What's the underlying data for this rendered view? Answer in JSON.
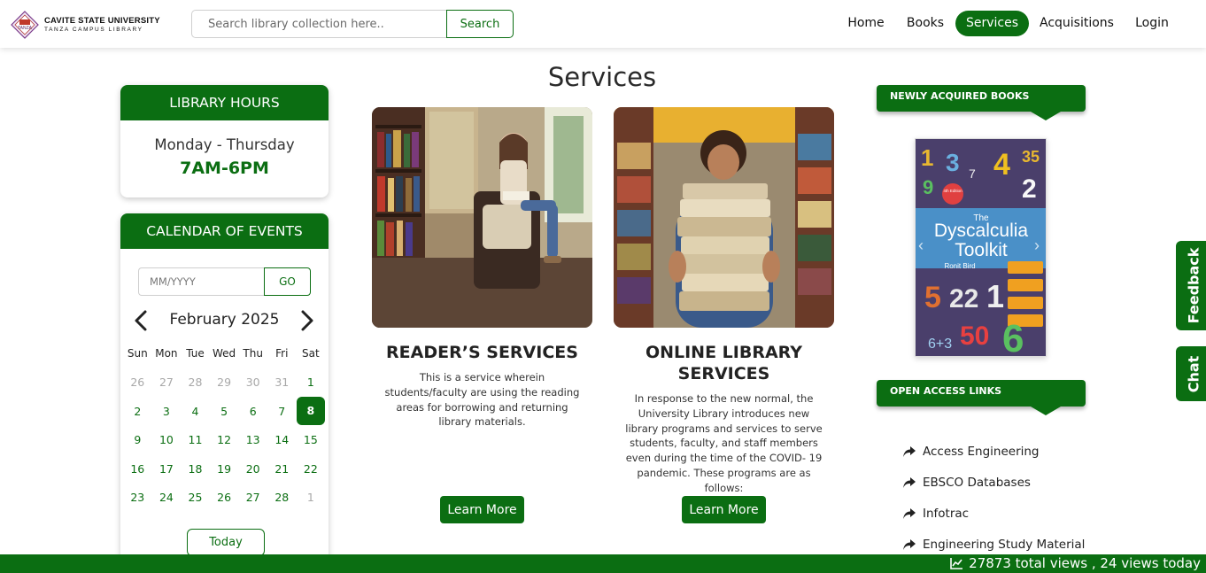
{
  "header": {
    "brand_title": "CAVITE STATE UNIVERSITY",
    "brand_subtitle": "TANZA CAMPUS LIBRARY",
    "logo_text": "TANZA",
    "search_placeholder": "Search library collection here..",
    "search_button": "Search",
    "nav": [
      {
        "label": "Home",
        "active": false
      },
      {
        "label": "Books",
        "active": false
      },
      {
        "label": "Services",
        "active": true
      },
      {
        "label": "Acquisitions",
        "active": false
      },
      {
        "label": "Login",
        "active": false
      }
    ]
  },
  "library_hours": {
    "title": "LIBRARY HOURS",
    "days": "Monday - Thursday",
    "time": "7AM-6PM"
  },
  "calendar": {
    "title": "CALENDAR OF EVENTS",
    "input_placeholder": "MM/YYYY",
    "go_button": "GO",
    "month_label": "February 2025",
    "weekdays": [
      "Sun",
      "Mon",
      "Tue",
      "Wed",
      "Thu",
      "Fri",
      "Sat"
    ],
    "weeks": [
      [
        {
          "d": "26",
          "m": true
        },
        {
          "d": "27",
          "m": true
        },
        {
          "d": "28",
          "m": true
        },
        {
          "d": "29",
          "m": true
        },
        {
          "d": "30",
          "m": true
        },
        {
          "d": "31",
          "m": true
        },
        {
          "d": "1"
        }
      ],
      [
        {
          "d": "2"
        },
        {
          "d": "3"
        },
        {
          "d": "4"
        },
        {
          "d": "5"
        },
        {
          "d": "6"
        },
        {
          "d": "7"
        },
        {
          "d": "8",
          "today": true
        }
      ],
      [
        {
          "d": "9"
        },
        {
          "d": "10"
        },
        {
          "d": "11"
        },
        {
          "d": "12"
        },
        {
          "d": "13"
        },
        {
          "d": "14"
        },
        {
          "d": "15"
        }
      ],
      [
        {
          "d": "16"
        },
        {
          "d": "17"
        },
        {
          "d": "18"
        },
        {
          "d": "19"
        },
        {
          "d": "20"
        },
        {
          "d": "21"
        },
        {
          "d": "22"
        }
      ],
      [
        {
          "d": "23"
        },
        {
          "d": "24"
        },
        {
          "d": "25"
        },
        {
          "d": "26"
        },
        {
          "d": "27"
        },
        {
          "d": "28"
        },
        {
          "d": "1",
          "m": true
        }
      ]
    ],
    "today_button": "Today"
  },
  "main": {
    "title": "Services",
    "services": [
      {
        "title": "READER’S SERVICES",
        "description": "This is a service wherein students/faculty are using the reading areas for borrowing and returning library materials.",
        "button": "Learn More"
      },
      {
        "title": "ONLINE LIBRARY SERVICES",
        "description": "In response to the new normal, the University Library introduces new library programs and services to serve students, faculty, and staff members even during the time of the COVID- 19 pandemic. These programs are as follows:",
        "button": "Learn More"
      }
    ]
  },
  "right": {
    "new_books_title": "NEWLY ACQUIRED BOOKS",
    "book": {
      "title_line1": "The",
      "title_line2": "Dyscalculia",
      "title_line3": "Toolkit",
      "author": "Ronit Bird",
      "edition": "4th Edition"
    },
    "open_access_title": "OPEN ACCESS LINKS",
    "links": [
      "Access Engineering",
      "EBSCO Databases",
      "Infotrac",
      "Engineering Study Material"
    ]
  },
  "side_tabs": {
    "feedback": "Feedback",
    "chat": "Chat"
  },
  "footer": {
    "stats": "27873 total views , 24 views today"
  },
  "colors": {
    "brand_green": "#0b6e12"
  }
}
